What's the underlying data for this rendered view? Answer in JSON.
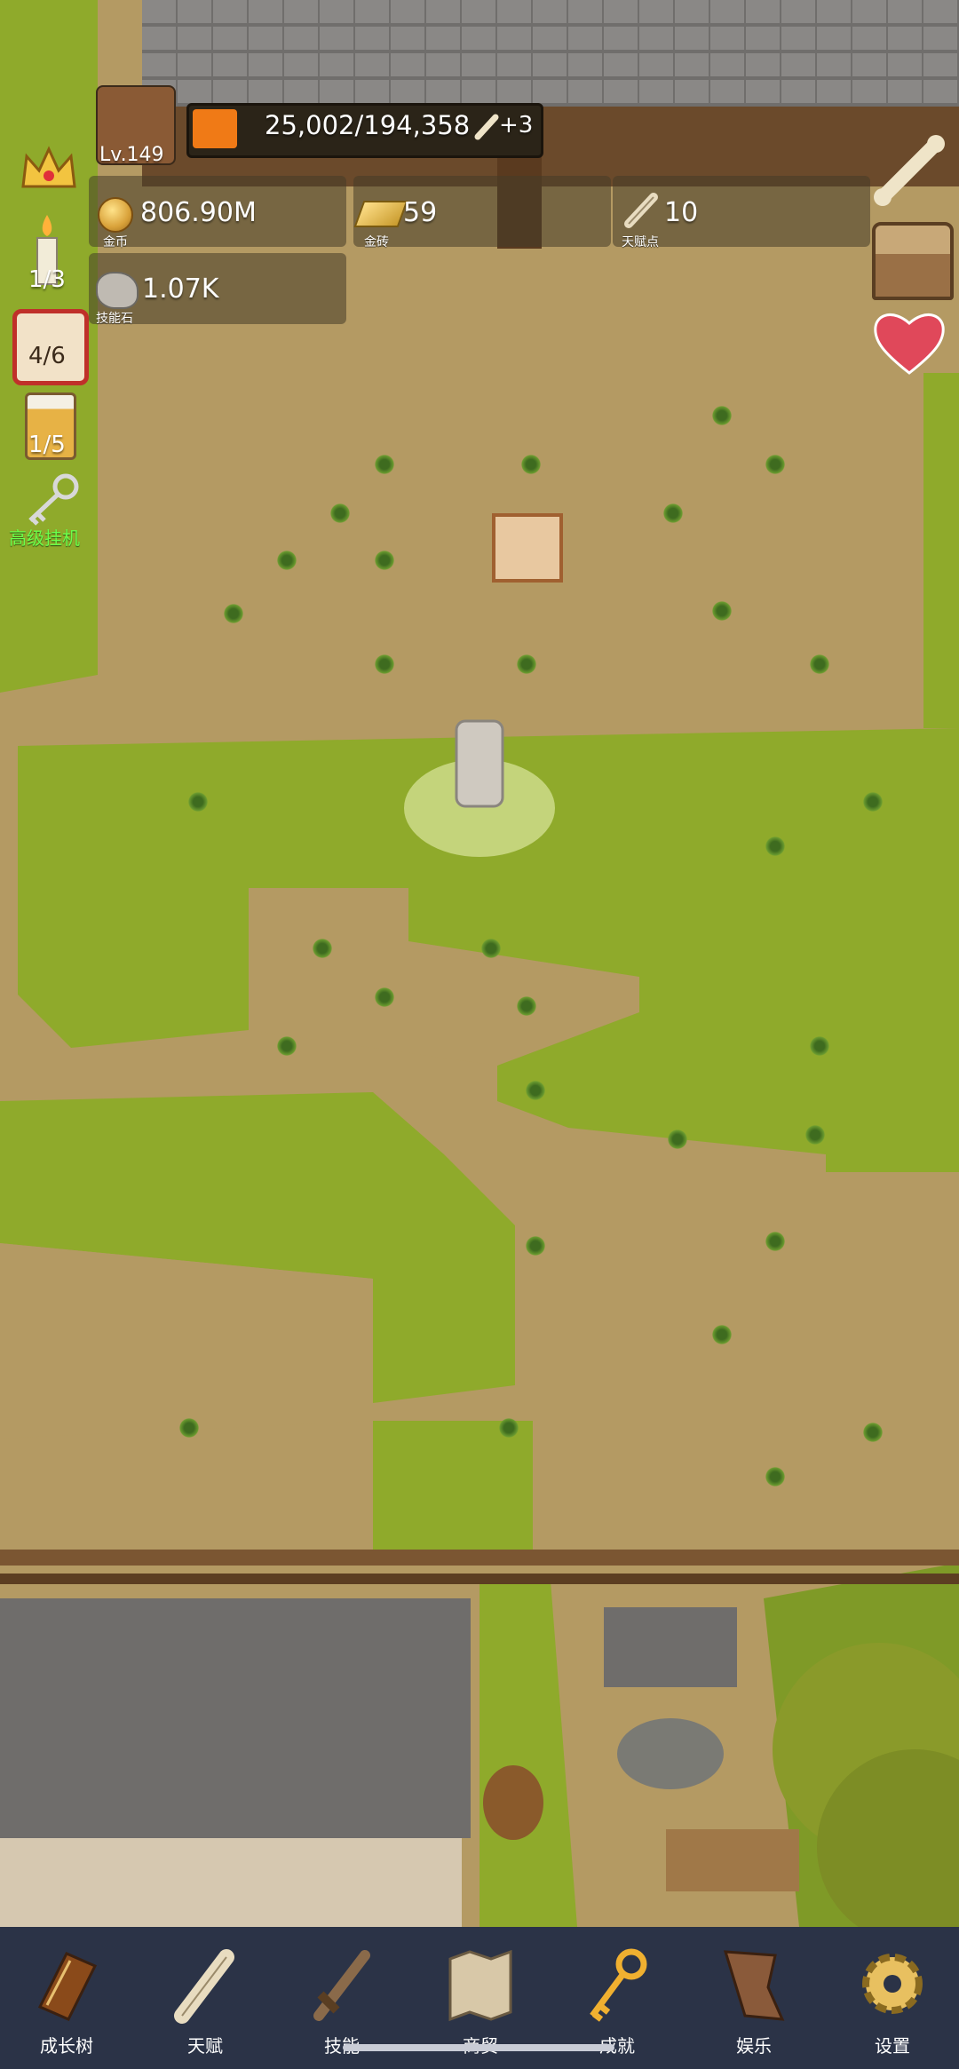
{
  "hud": {
    "level": "Lv.149",
    "exp": {
      "current": "25,002",
      "max": "194,358",
      "text": "25,002/194,358",
      "bonus": "+3",
      "fill_fraction": 0.1286
    },
    "gold": {
      "value": "806.90M",
      "label": "金币"
    },
    "gold_bar": {
      "value": "59",
      "label": "金砖"
    },
    "talent_points": {
      "value": "10",
      "label": "天赋点"
    },
    "skill_stone": {
      "value": "1.07K",
      "label": "技能石"
    }
  },
  "left_icons": {
    "candle_count": "1/3",
    "dice_count": "4/6",
    "beer_count": "1/5",
    "auto_idle_label": "高级挂机"
  },
  "right_icons": [
    "bone-icon",
    "treasure-chest-icon",
    "heart-icon"
  ],
  "bottom_nav": [
    {
      "label": "成长树",
      "icon": "book-icon"
    },
    {
      "label": "天赋",
      "icon": "scroll-icon"
    },
    {
      "label": "技能",
      "icon": "sword-icon"
    },
    {
      "label": "商贸",
      "icon": "map-icon"
    },
    {
      "label": "成就",
      "icon": "key-icon"
    },
    {
      "label": "娱乐",
      "icon": "flag-icon"
    },
    {
      "label": "设置",
      "icon": "gear-icon"
    }
  ],
  "colors": {
    "exp_fill": "#f07a16",
    "navbar": "#2b3347",
    "auto_idle_text": "#6cff4a",
    "dirt": "#b49a63",
    "grass": "#8faa2b"
  }
}
